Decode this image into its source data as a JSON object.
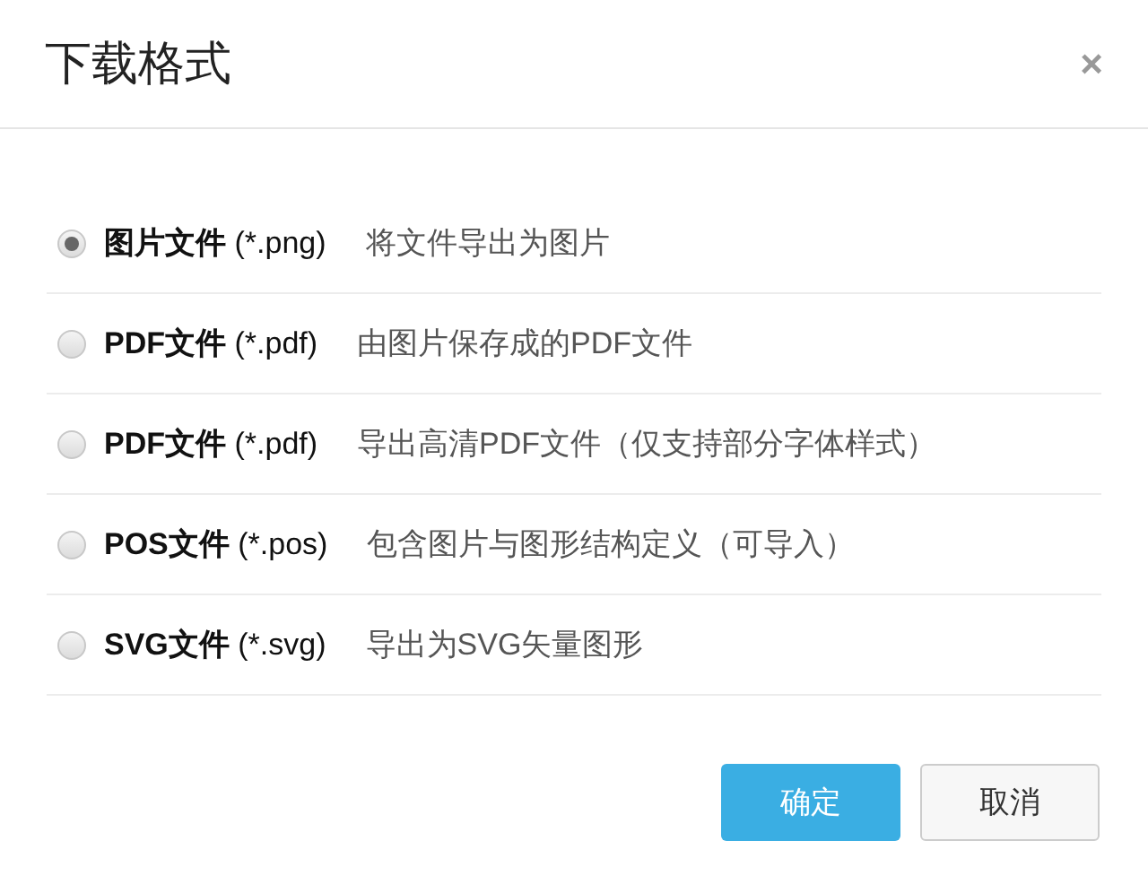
{
  "dialog": {
    "title": "下载格式",
    "close": "×"
  },
  "options": [
    {
      "name": "图片文件",
      "ext": "(*.png)",
      "description": "将文件导出为图片",
      "selected": true
    },
    {
      "name": "PDF文件",
      "ext": "(*.pdf)",
      "description": "由图片保存成的PDF文件",
      "selected": false
    },
    {
      "name": "PDF文件",
      "ext": "(*.pdf)",
      "description": "导出高清PDF文件（仅支持部分字体样式）",
      "selected": false
    },
    {
      "name": "POS文件",
      "ext": "(*.pos)",
      "description": "包含图片与图形结构定义（可导入）",
      "selected": false
    },
    {
      "name": "SVG文件",
      "ext": "(*.svg)",
      "description": "导出为SVG矢量图形",
      "selected": false
    }
  ],
  "buttons": {
    "ok": "确定",
    "cancel": "取消"
  }
}
